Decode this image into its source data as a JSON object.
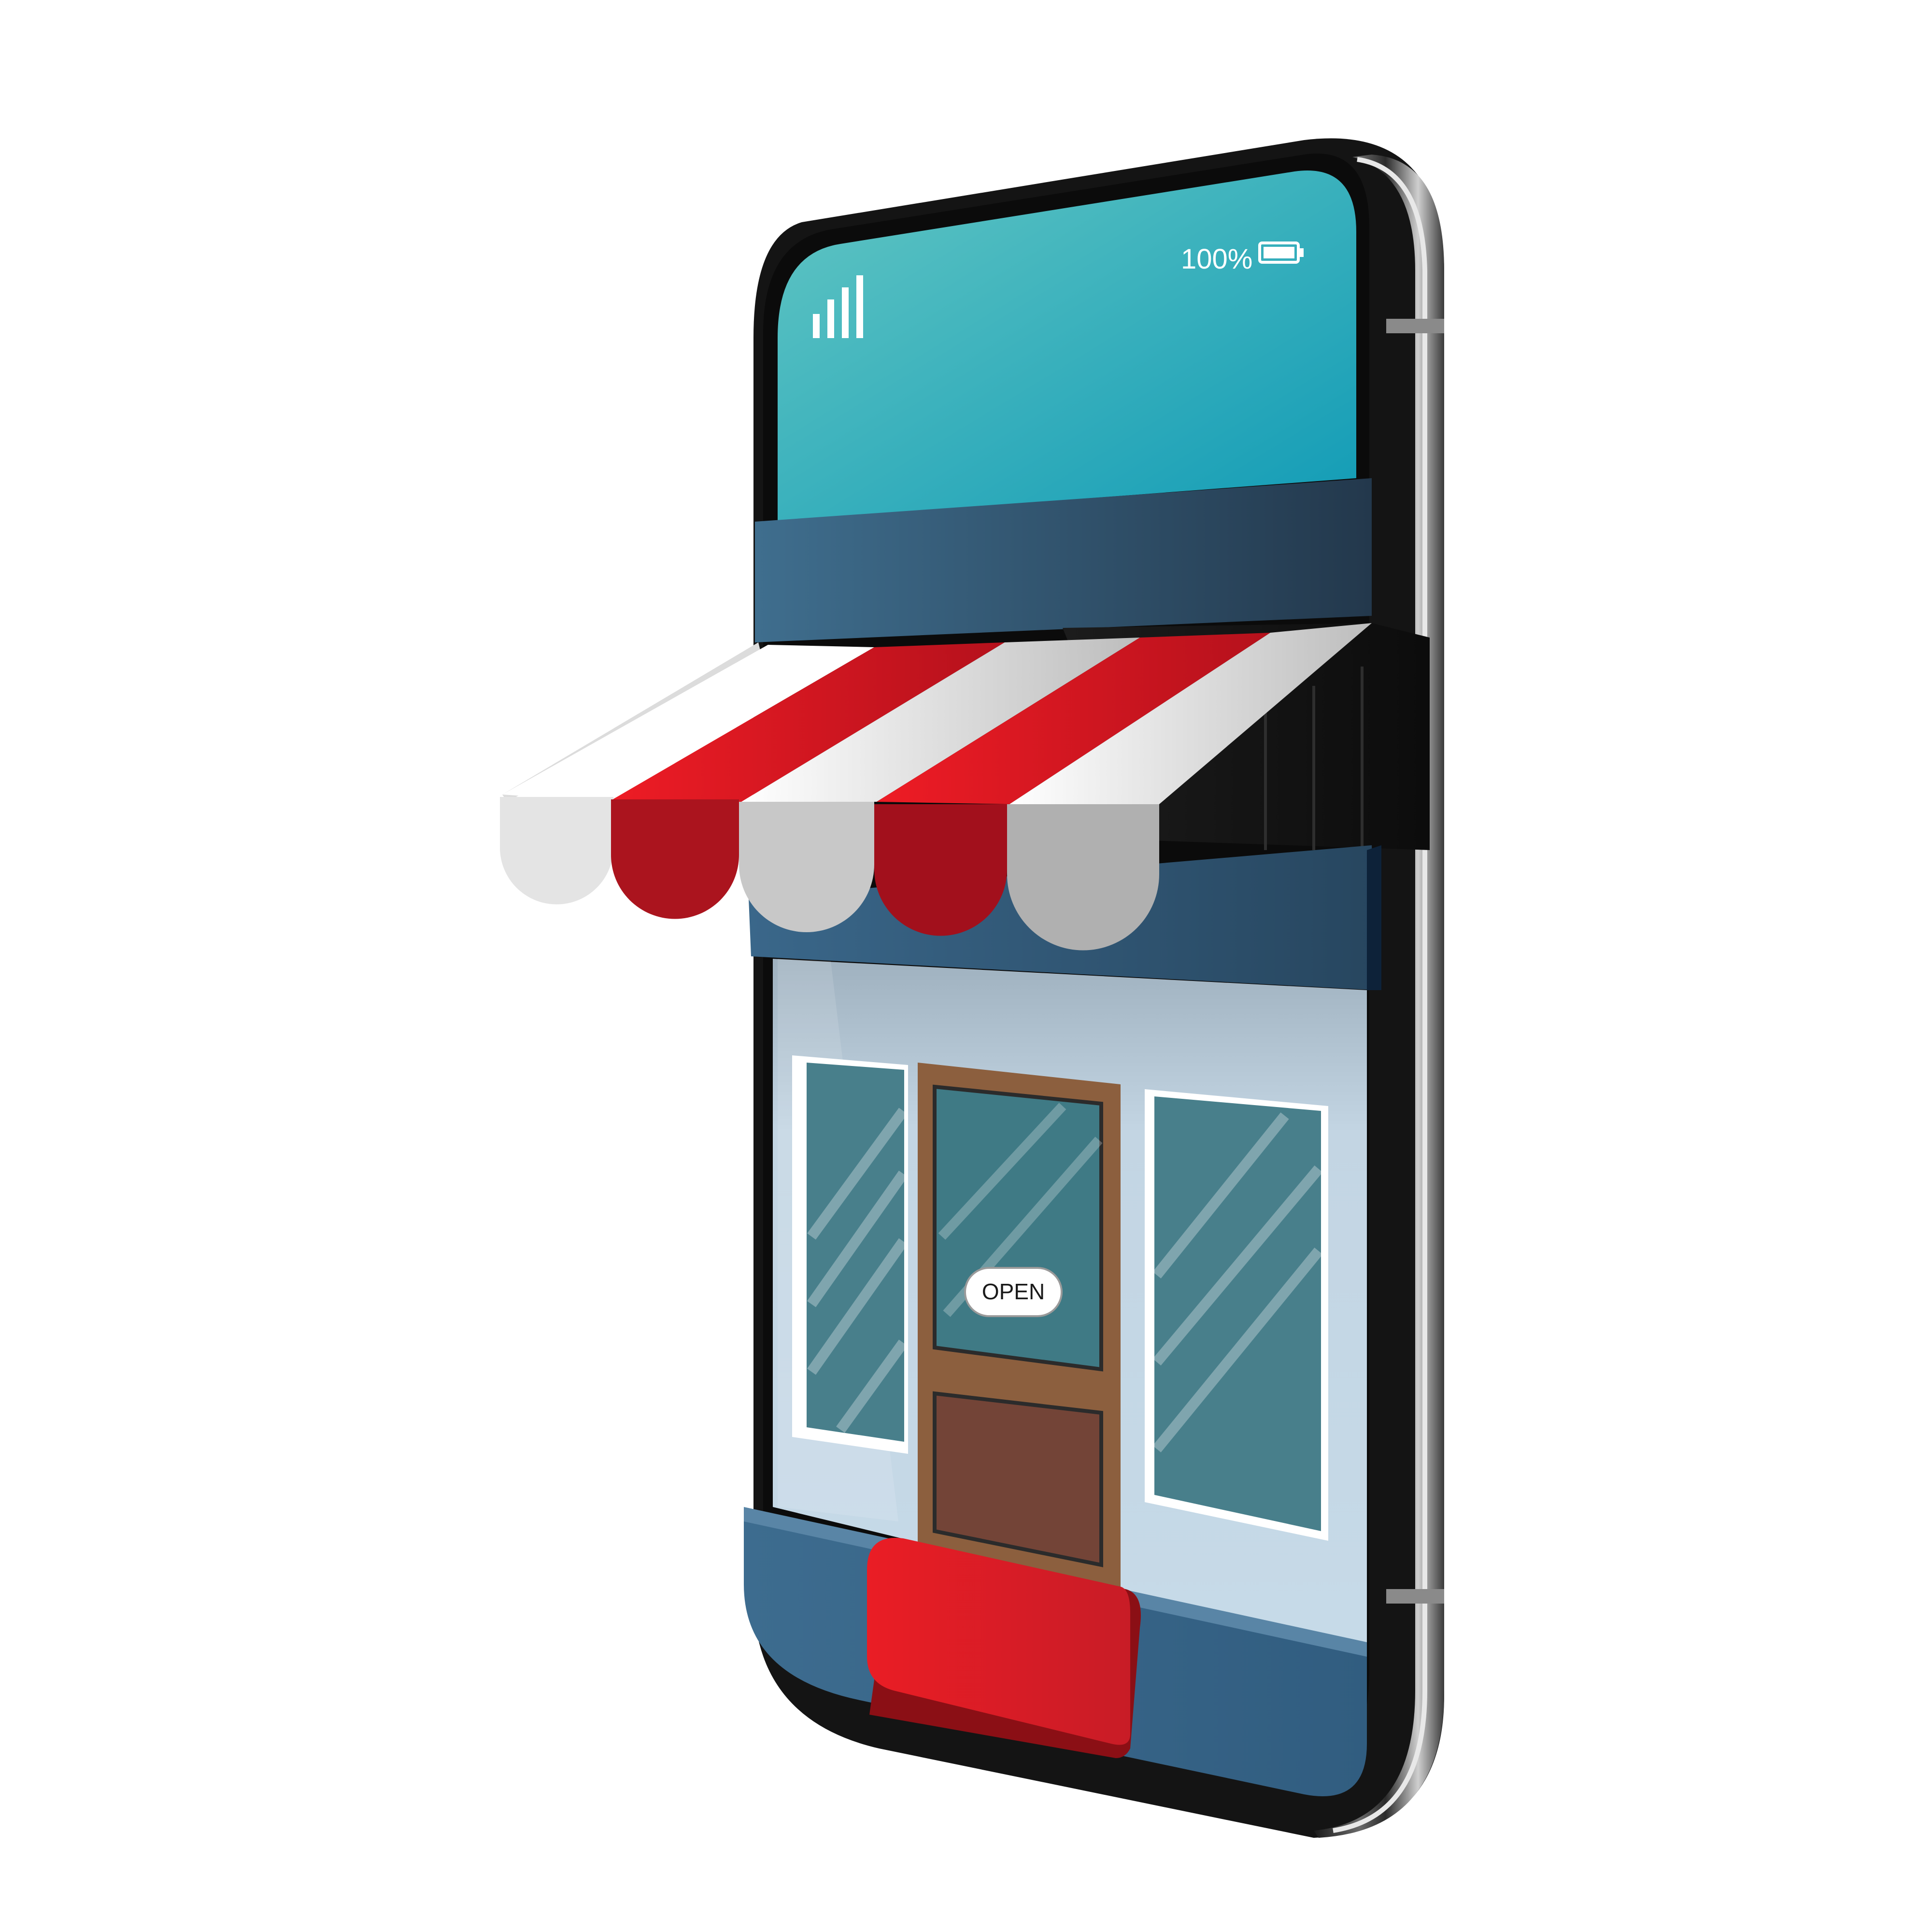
{
  "status_bar": {
    "battery_text": "100%",
    "signal_icon": "signal-bars-icon",
    "battery_icon": "battery-full-icon"
  },
  "storefront": {
    "door_sign": "OPEN"
  },
  "colors": {
    "screen_top": "#5bc2c3",
    "screen_bottom": "#159fb5",
    "fascia": "#3a6685",
    "awning_red": "#e8202b",
    "awning_white": "#f2f2f2",
    "window_glass": "#477f8a",
    "door_frame": "#8a5a3a",
    "door_panel": "#734437",
    "red_button": "#e01b24",
    "phone_body": "#1d1d1f"
  }
}
